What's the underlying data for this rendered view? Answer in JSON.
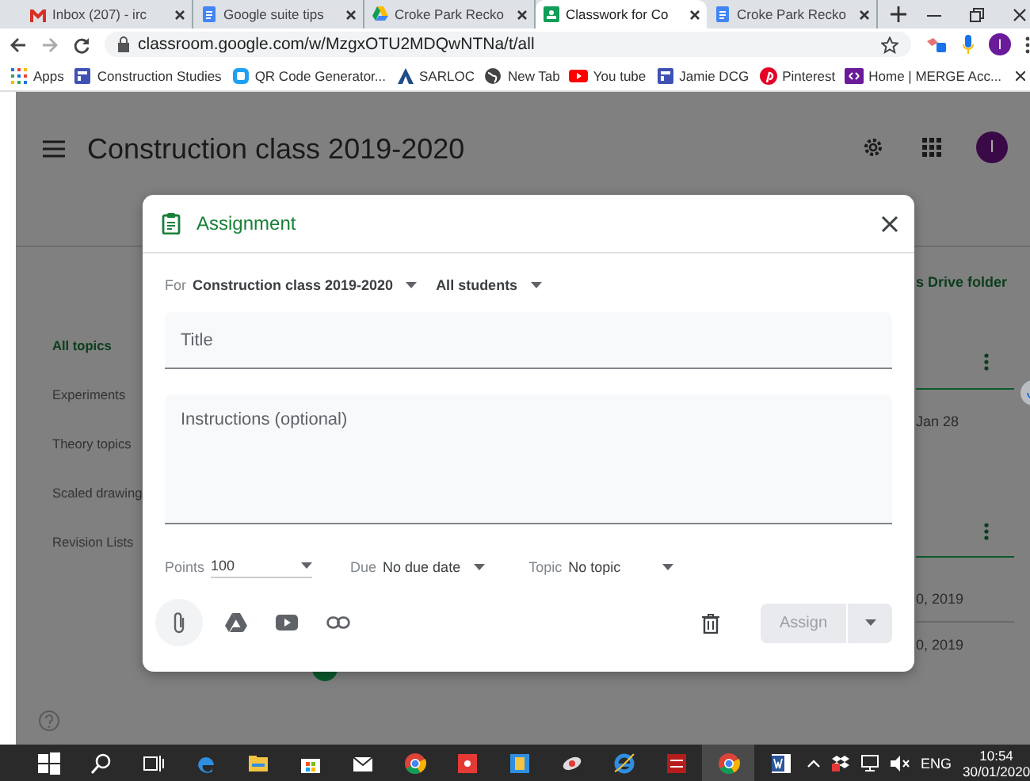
{
  "browser": {
    "tabs": [
      {
        "title": "Inbox (207) - irc",
        "selected": false
      },
      {
        "title": "Google suite tips",
        "selected": false
      },
      {
        "title": "Croke Park Recko",
        "selected": false
      },
      {
        "title": "Classwork for Co",
        "selected": true
      },
      {
        "title": "Croke Park Recko",
        "selected": false
      }
    ],
    "url": "classroom.google.com/w/MzgxOTU2MDQwNTNa/t/all",
    "profile": "I",
    "bookmarks": [
      "Apps",
      "Construction Studies",
      "QR Code Generator...",
      "SARLOC",
      "New Tab",
      "You tube",
      "Jamie DCG",
      "Pinterest",
      "Home | MERGE Acc..."
    ]
  },
  "header": {
    "title": "Construction class 2019-2020",
    "avatar": "I"
  },
  "sidebar": {
    "items": [
      {
        "label": "All topics",
        "selected": true
      },
      {
        "label": "Experiments",
        "selected": false
      },
      {
        "label": "Theory topics",
        "selected": false
      },
      {
        "label": "Scaled drawing",
        "selected": false
      },
      {
        "label": "Revision Lists",
        "selected": false
      }
    ]
  },
  "right_column": {
    "drive_link": "s Drive folder",
    "dates": [
      "Jan 28",
      "0, 2019",
      "0, 2019"
    ]
  },
  "dialog": {
    "title": "Assignment",
    "for_label": "For",
    "class": "Construction class 2019-2020",
    "students": "All students",
    "title_field": {
      "placeholder": "Title"
    },
    "instructions_field": {
      "placeholder": "Instructions (optional)"
    },
    "points_label": "Points",
    "points": "100",
    "due_label": "Due",
    "due": "No due date",
    "topic_label": "Topic",
    "topic": "No topic",
    "assign_button": {
      "label": "Assign",
      "disabled": true
    }
  },
  "taskbar": {
    "language": "ENG",
    "time": "10:54",
    "date": "30/01/2020"
  }
}
